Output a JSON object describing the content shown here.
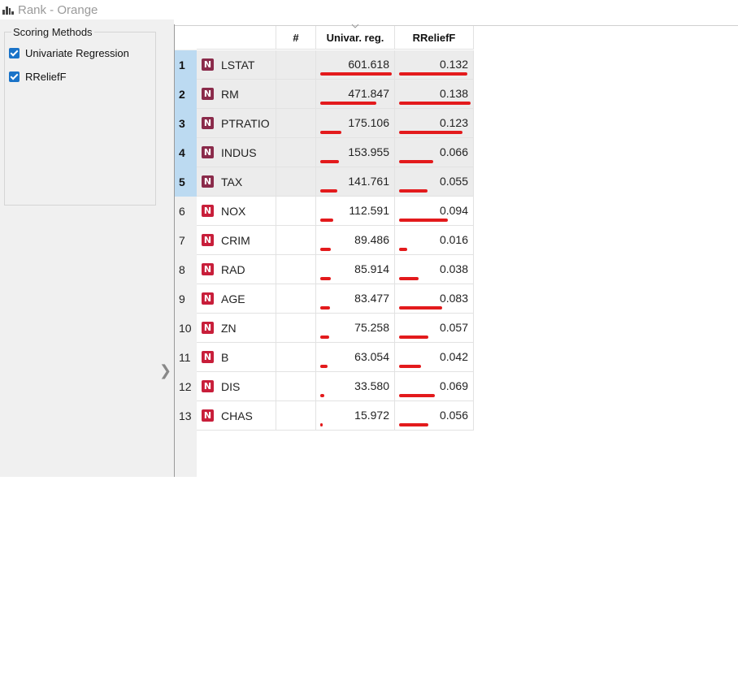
{
  "window": {
    "title": "Rank - Orange",
    "icon": "orange-rank-icon"
  },
  "scoring_methods": {
    "title": "Scoring Methods",
    "items": [
      {
        "label": "Univariate Regression",
        "checked": true
      },
      {
        "label": "RReliefF",
        "checked": true
      }
    ]
  },
  "table": {
    "headers": {
      "name": "",
      "num": "#",
      "univar": "Univar. reg.",
      "rrelieff": "RReliefF"
    },
    "sorted_column": "Univar. reg.",
    "bar_color": "#e31a1c",
    "rows": [
      {
        "index": "1",
        "type": "N",
        "name": "LSTAT",
        "num": "",
        "univar": "601.618",
        "rrelieff": "0.132",
        "selected": true
      },
      {
        "index": "2",
        "type": "N",
        "name": "RM",
        "num": "",
        "univar": "471.847",
        "rrelieff": "0.138",
        "selected": true
      },
      {
        "index": "3",
        "type": "N",
        "name": "PTRATIO",
        "num": "",
        "univar": "175.106",
        "rrelieff": "0.123",
        "selected": true
      },
      {
        "index": "4",
        "type": "N",
        "name": "INDUS",
        "num": "",
        "univar": "153.955",
        "rrelieff": "0.066",
        "selected": true
      },
      {
        "index": "5",
        "type": "N",
        "name": "TAX",
        "num": "",
        "univar": "141.761",
        "rrelieff": "0.055",
        "selected": true
      },
      {
        "index": "6",
        "type": "N",
        "name": "NOX",
        "num": "",
        "univar": "112.591",
        "rrelieff": "0.094",
        "selected": false
      },
      {
        "index": "7",
        "type": "N",
        "name": "CRIM",
        "num": "",
        "univar": "89.486",
        "rrelieff": "0.016",
        "selected": false
      },
      {
        "index": "8",
        "type": "N",
        "name": "RAD",
        "num": "",
        "univar": "85.914",
        "rrelieff": "0.038",
        "selected": false
      },
      {
        "index": "9",
        "type": "N",
        "name": "AGE",
        "num": "",
        "univar": "83.477",
        "rrelieff": "0.083",
        "selected": false
      },
      {
        "index": "10",
        "type": "N",
        "name": "ZN",
        "num": "",
        "univar": "75.258",
        "rrelieff": "0.057",
        "selected": false
      },
      {
        "index": "11",
        "type": "N",
        "name": "B",
        "num": "",
        "univar": "63.054",
        "rrelieff": "0.042",
        "selected": false
      },
      {
        "index": "12",
        "type": "N",
        "name": "DIS",
        "num": "",
        "univar": "33.580",
        "rrelieff": "0.069",
        "selected": false
      },
      {
        "index": "13",
        "type": "N",
        "name": "CHAS",
        "num": "",
        "univar": "15.972",
        "rrelieff": "0.056",
        "selected": false
      }
    ]
  }
}
